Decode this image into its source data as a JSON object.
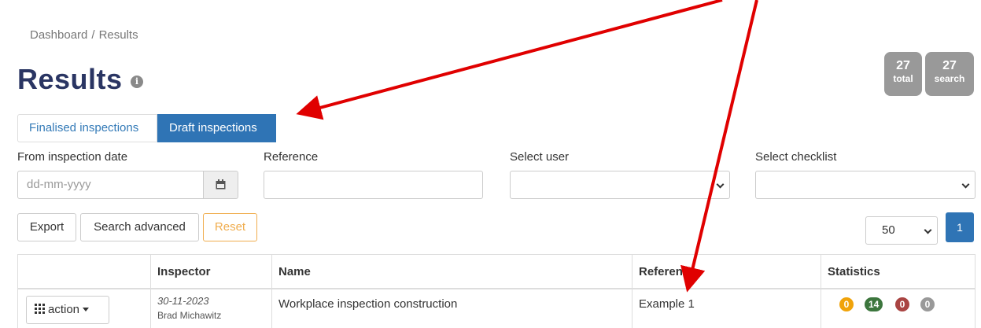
{
  "breadcrumb": {
    "items": [
      "Dashboard",
      "Results"
    ],
    "separator": "/"
  },
  "page": {
    "title": "Results",
    "info_icon": "i"
  },
  "counts": [
    {
      "value": "27",
      "label": "total"
    },
    {
      "value": "27",
      "label": "search"
    }
  ],
  "tabs": [
    {
      "label": "Finalised inspections",
      "active": false
    },
    {
      "label": "Draft inspections",
      "active": true
    }
  ],
  "filters": {
    "from_date": {
      "label": "From inspection date",
      "placeholder": "dd-mm-yyyy",
      "calendar_icon": "calendar-icon"
    },
    "reference": {
      "label": "Reference",
      "value": ""
    },
    "user": {
      "label": "Select user",
      "value": ""
    },
    "checklist": {
      "label": "Select checklist",
      "value": ""
    }
  },
  "toolbar": {
    "export": "Export",
    "search_advanced": "Search advanced",
    "reset": "Reset"
  },
  "pagination": {
    "per_page": "50",
    "current_page": "1"
  },
  "table": {
    "headers": [
      "",
      "Inspector",
      "Name",
      "Reference",
      "Statistics"
    ],
    "rows": [
      {
        "action_label": "action",
        "date": "30-11-2023",
        "inspector": "Brad Michawitz",
        "name": "Workplace inspection construction",
        "reference": "Example 1",
        "stats": [
          {
            "value": "0",
            "color": "#f0a30a"
          },
          {
            "value": "14",
            "color": "#3c763d"
          },
          {
            "value": "0",
            "color": "#a94442"
          },
          {
            "value": "0",
            "color": "#999999"
          }
        ]
      }
    ]
  },
  "colors": {
    "brand_title": "#2a3563",
    "primary": "#2f74b5",
    "warning": "#f0ad4e",
    "annotation_arrow": "#e00000"
  }
}
